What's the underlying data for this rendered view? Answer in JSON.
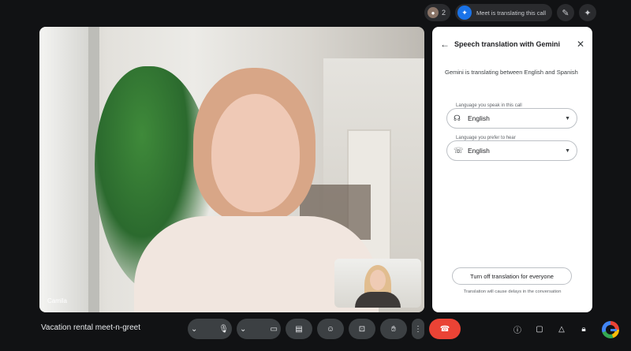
{
  "topbar": {
    "participants_count": "2",
    "status_text": "Meet is translating this call",
    "icons": [
      "participants-icon",
      "translate-status-icon",
      "visual-effects-icon",
      "gemini-icon"
    ]
  },
  "video": {
    "main_participant": "Camila"
  },
  "panel": {
    "title": "Speech translation with Gemini",
    "description": "Gemini is translating between English and Spanish",
    "speak_label": "Language you speak in this call",
    "speak_value": "English",
    "hear_label": "Language you prefer to hear",
    "hear_value": "English",
    "turn_off_label": "Turn off translation for everyone",
    "note": "Translation will cause delays in the conversation"
  },
  "bottom": {
    "meeting_title": "Vacation rental meet-n-greet",
    "controls": [
      "mic-options",
      "mic",
      "camera-options",
      "camera",
      "captions",
      "emoji",
      "present",
      "raise-hand",
      "more-options",
      "end-call"
    ],
    "right_controls": [
      "meeting-info",
      "chat",
      "activities",
      "host-controls"
    ]
  },
  "colors": {
    "end_call": "#ea4335",
    "accent_blue": "#1a73e8",
    "panel_bg": "#ffffff",
    "page_bg": "#111214"
  }
}
